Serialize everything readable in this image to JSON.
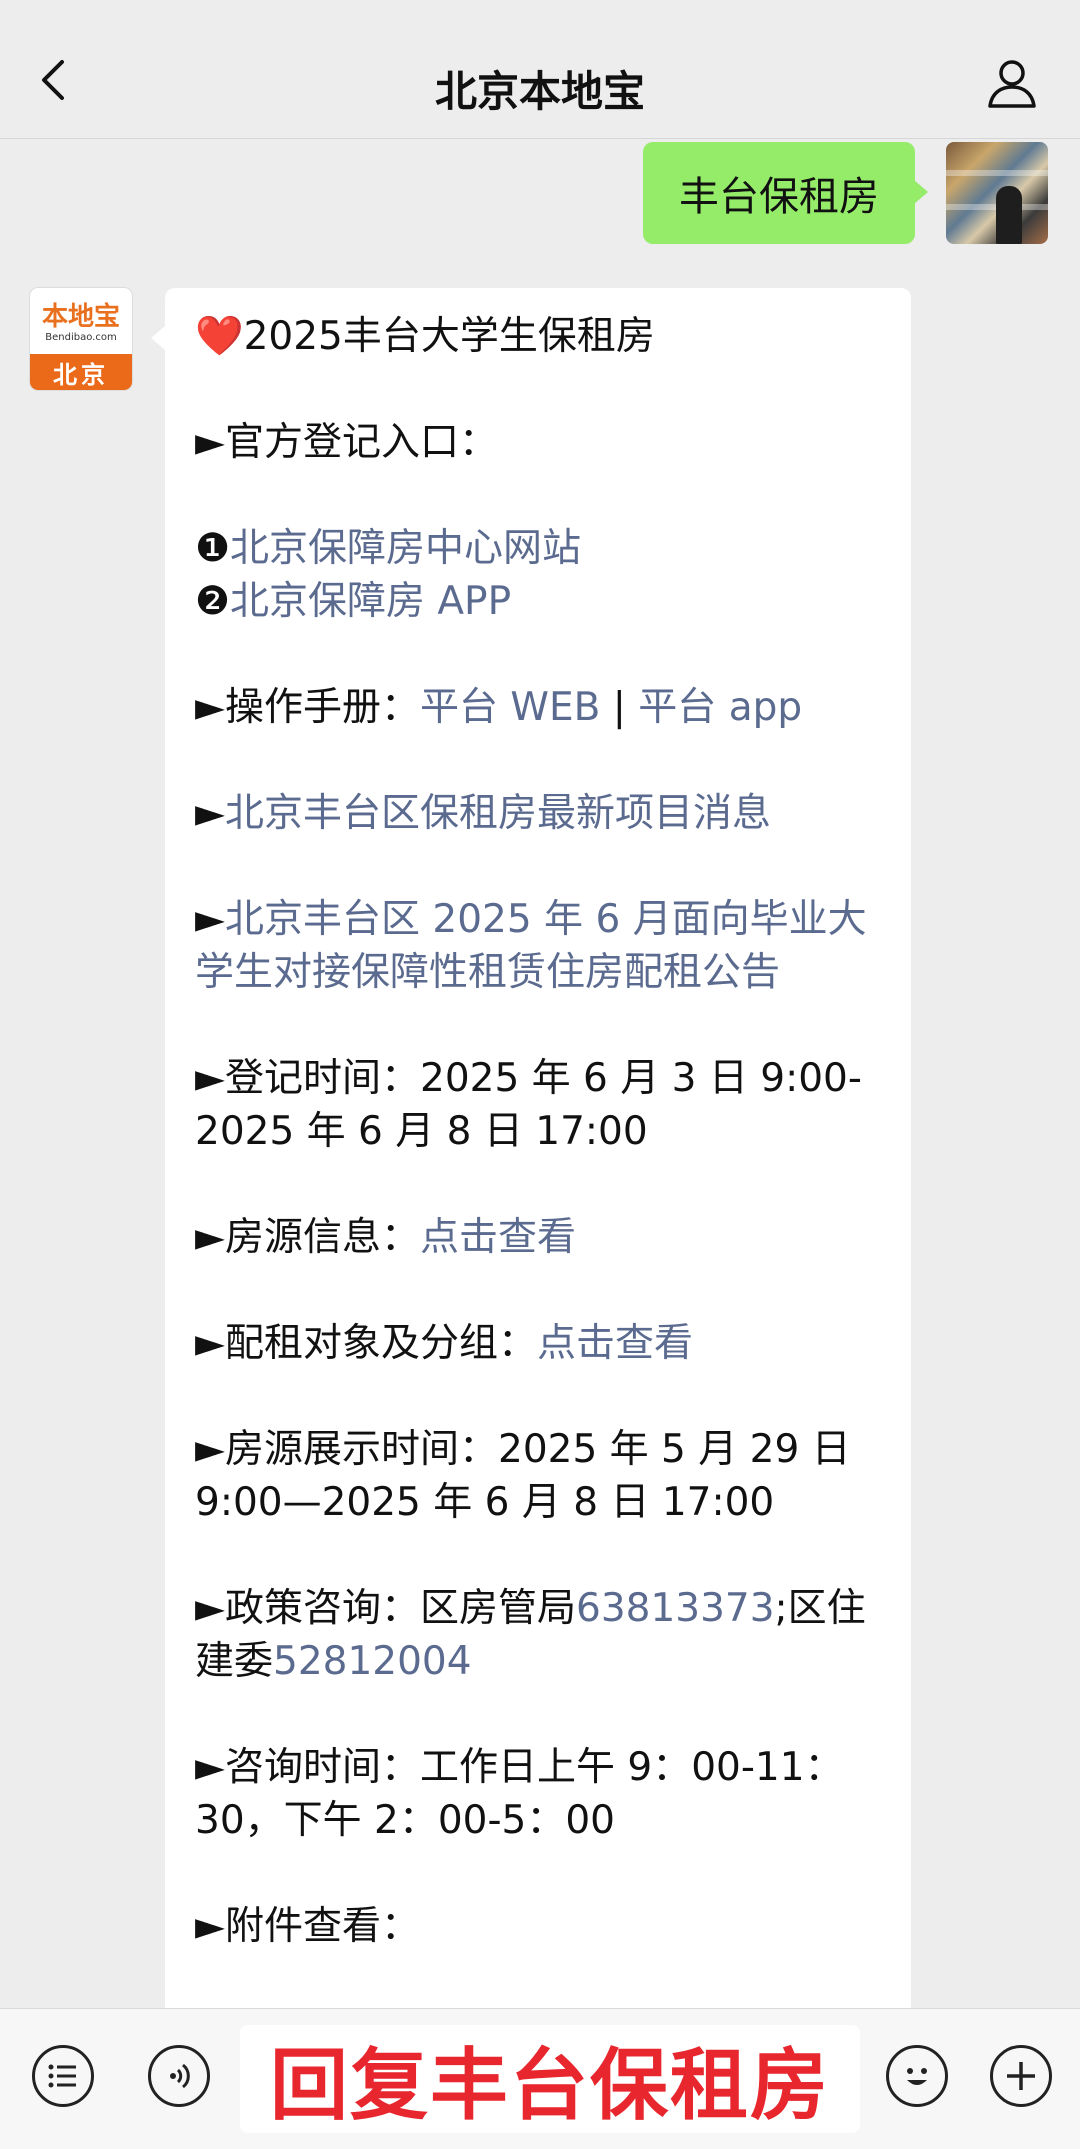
{
  "header": {
    "title": "北京本地宝"
  },
  "outgoing": {
    "text": "丰台保租房"
  },
  "bot_avatar": {
    "top": "本地宝",
    "sub": "Bendibao.com",
    "bottom": "北京"
  },
  "message": {
    "heart": "❤️",
    "title": "2025丰台大学生保租房",
    "entry_label": "►官方登记入口：",
    "entry_1_num": "❶",
    "entry_1_link": "北京保障房中心网站",
    "entry_2_num": "❷",
    "entry_2_link": "北京保障房 APP",
    "manual_label": "►操作手册：",
    "manual_web": "平台 WEB",
    "manual_sep": " | ",
    "manual_app": "平台 app",
    "news_arrow": "►",
    "news_link": "北京丰台区保租房最新项目消息",
    "notice_arrow": "►",
    "notice_link": "北京丰台区 2025 年 6 月面向毕业大学生对接保障性租赁住房配租公告",
    "reg_time_label": "►登记时间：",
    "reg_time_value": "2025 年 6 月 3 日 9:00-2025 年 6 月 8 日 17:00",
    "housing_label": "►房源信息：",
    "housing_link": "点击查看",
    "target_label": "►配租对象及分组：",
    "target_link": "点击查看",
    "display_label": "►房源展示时间：",
    "display_value": "2025 年 5 月 29 日 9:00—2025 年 6 月 8 日 17:00",
    "policy_label": "►政策咨询：",
    "policy_text_1": "区房管局",
    "policy_phone_1": "63813373",
    "policy_text_2": ";区住建委",
    "policy_phone_2": "52812004",
    "consult_label": "►咨询时间：",
    "consult_value": "工作日上午 9：00-11：30，下午 2：00-5：00",
    "attach_label": "►附件查看："
  },
  "input_bar": {
    "menu_icon": "list-icon",
    "voice_icon": "voice-icon",
    "reply_text": "回复丰台保租房",
    "emoji_icon": "emoji-icon",
    "plus_icon": "plus-icon"
  }
}
